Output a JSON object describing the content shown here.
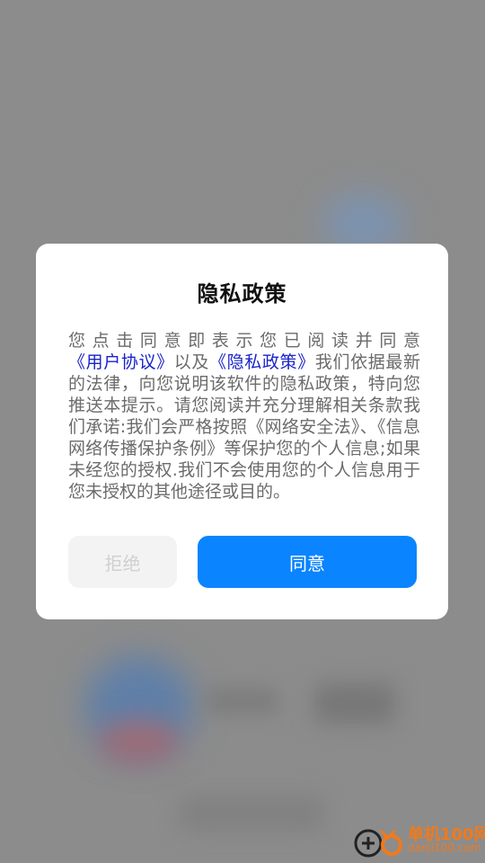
{
  "dialog": {
    "title": "隐私政策",
    "body_segments": [
      {
        "text": "您点击同意即表示您已阅读并同意",
        "link": false
      },
      {
        "text": "《用户协议》",
        "link": true
      },
      {
        "text": "以及",
        "link": false
      },
      {
        "text": "《隐私政策》",
        "link": true
      },
      {
        "text": "我们依据最新的法律，向您说明该软件的隐私政策，特向您推送本提示。请您阅读并充分理解相关条款我们承诺:我们会严格按照《网络安全法》、《信息网络传播保护条例》等保护您的个人信息;如果未经您的授权.我们不会使用您的个人信息用于您未授权的其他途径或目的。",
        "link": false
      }
    ],
    "reject_label": "拒绝",
    "agree_label": "同意"
  },
  "watermark": {
    "name": "单机100网",
    "domain": "danji100.com"
  },
  "colors": {
    "accent": "#0a84ff",
    "link": "#1a23c9",
    "overlay": "#8c8c8c",
    "watermark": "#f07a1c"
  }
}
